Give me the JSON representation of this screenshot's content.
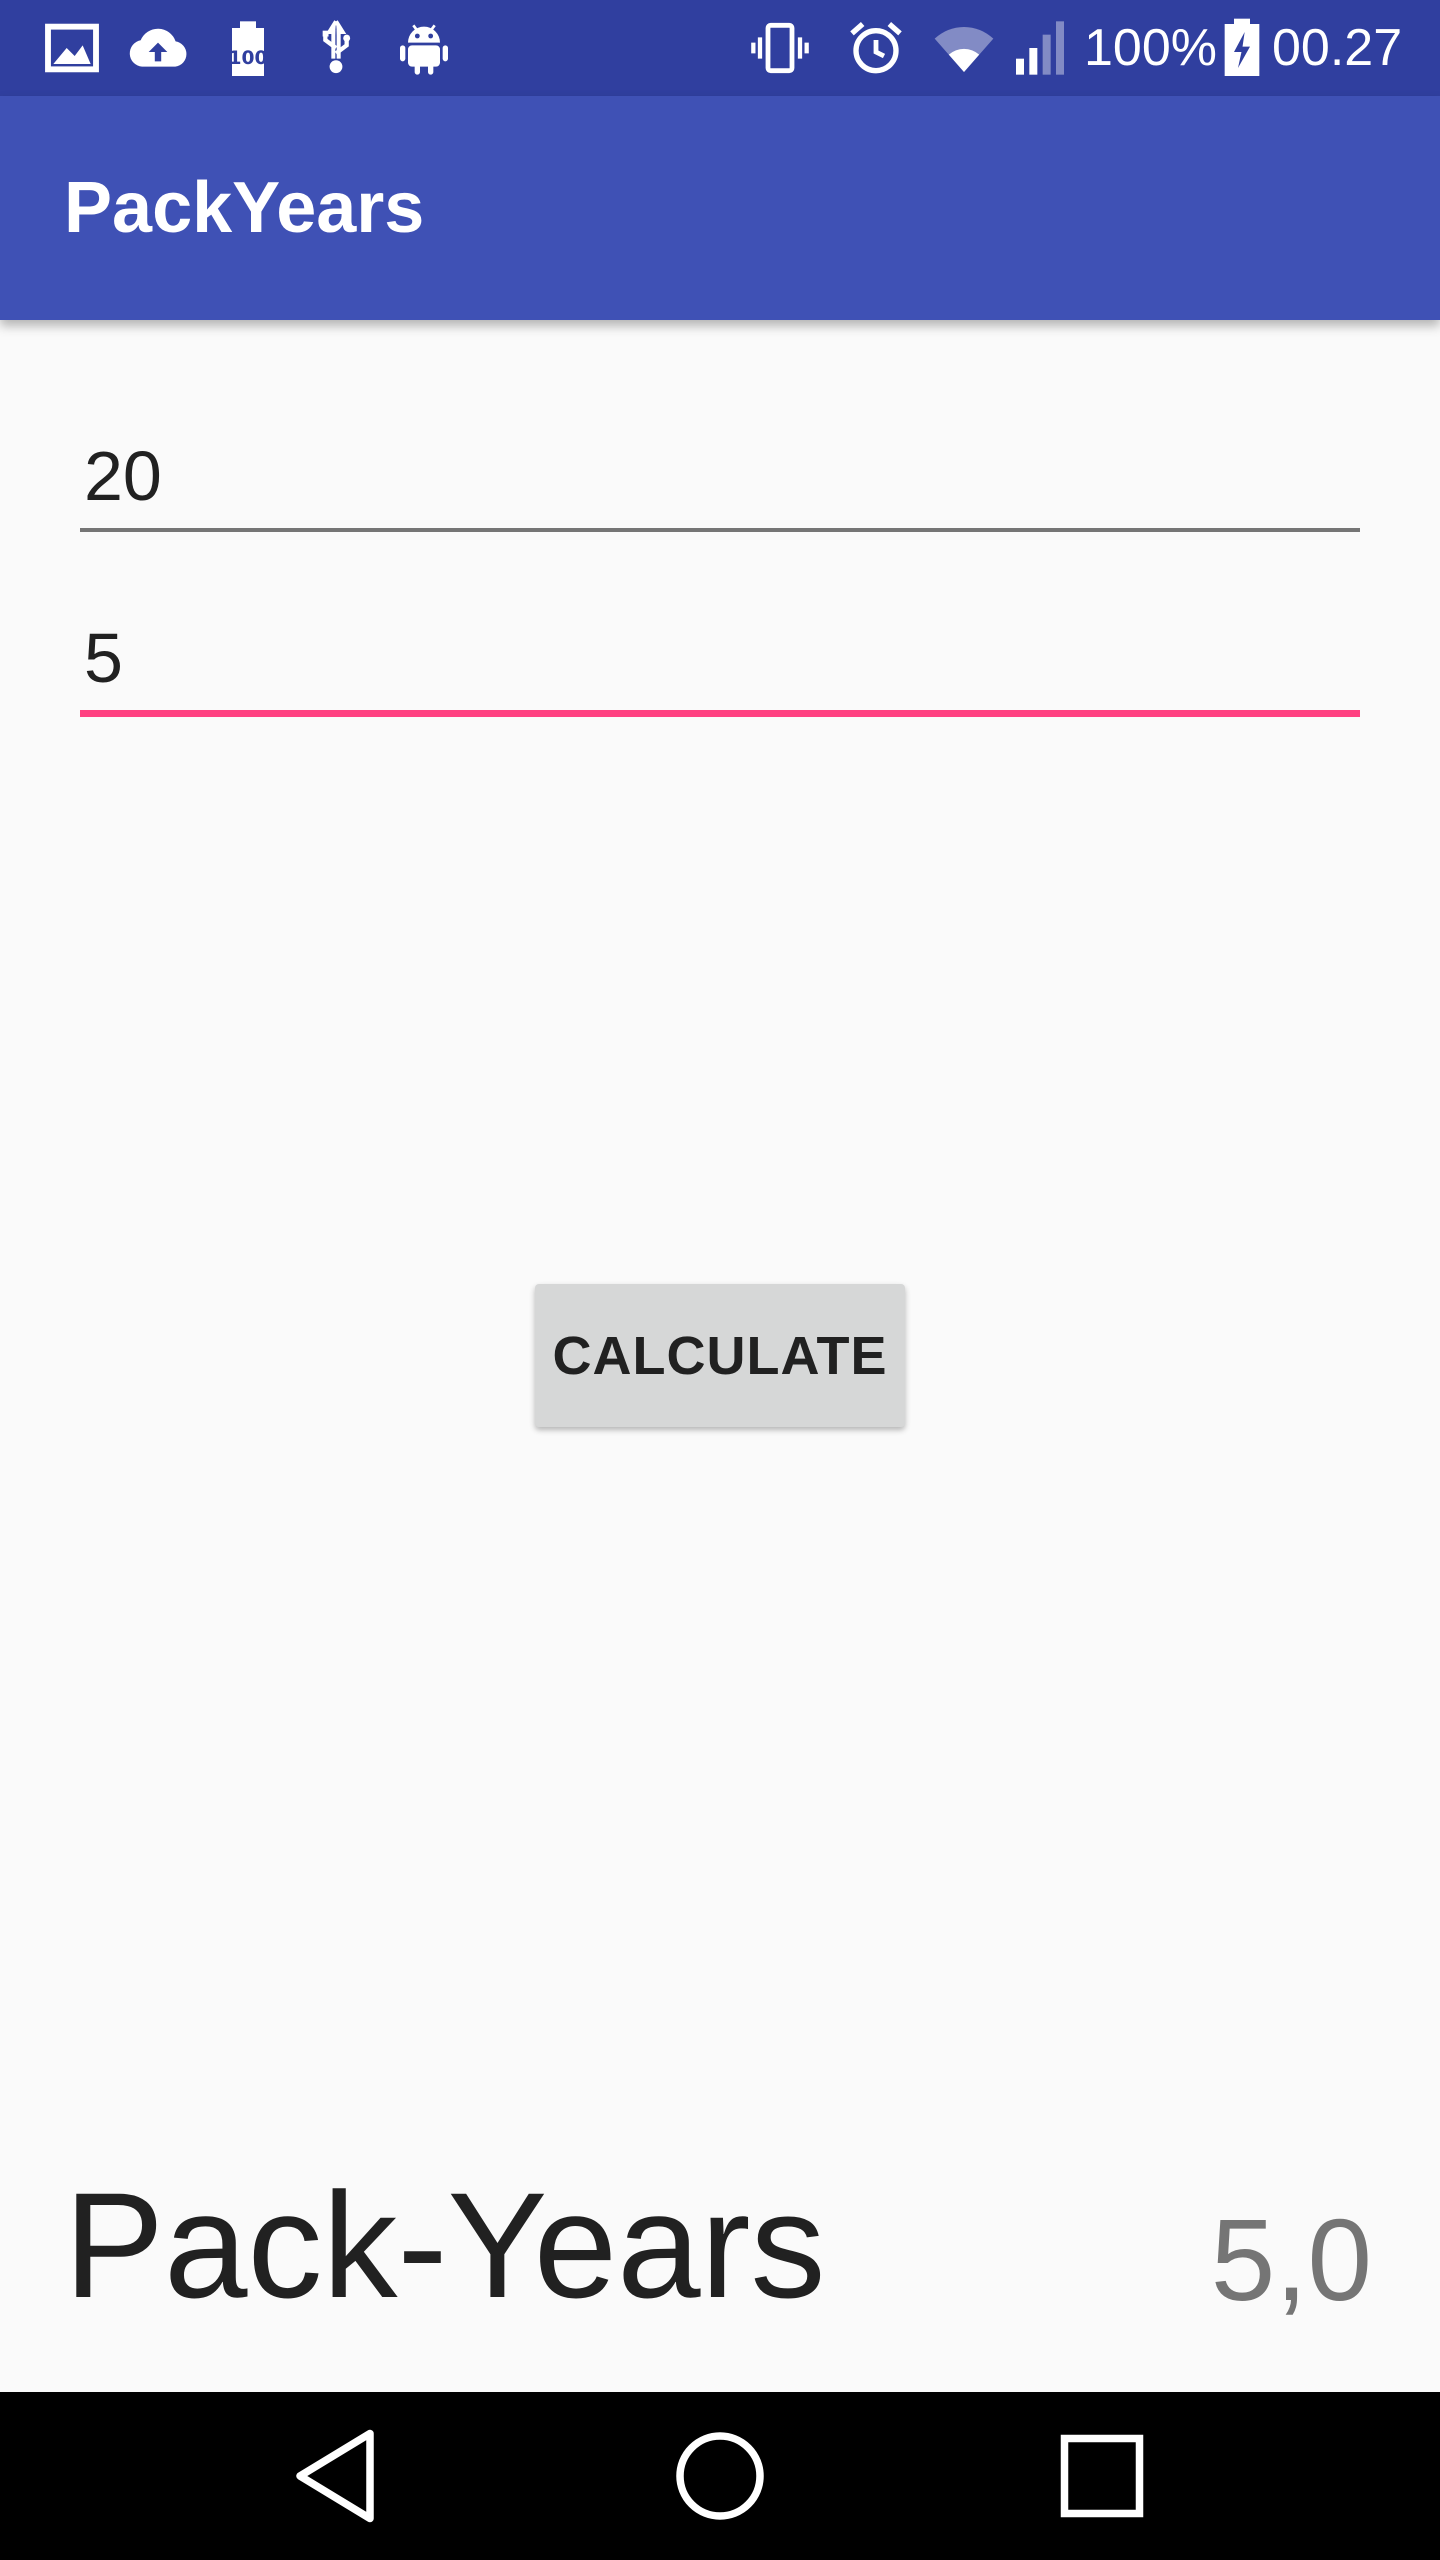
{
  "status_bar": {
    "left_icons": [
      "image-icon",
      "cloud-upload-icon",
      "battery-100-icon",
      "usb-icon",
      "android-debug-icon"
    ],
    "right_icons": [
      "vibrate-icon",
      "alarm-icon",
      "wifi-icon",
      "cell-signal-icon",
      "battery-charging-icon"
    ],
    "battery_percent": "100%",
    "time": "00.27"
  },
  "app_bar": {
    "title": "PackYears"
  },
  "form": {
    "packs_value": "20",
    "years_value": "5",
    "calculate_label": "CALCULATE"
  },
  "result": {
    "label": "Pack-Years",
    "value": "5,0"
  },
  "nav_bar": {
    "buttons": [
      "back-icon",
      "home-icon",
      "recents-icon"
    ]
  },
  "colors": {
    "status_bar": "#303f9f",
    "primary": "#3f51b5",
    "accent": "#ff4081",
    "background": "#fafafa",
    "button": "#d6d7d7"
  }
}
